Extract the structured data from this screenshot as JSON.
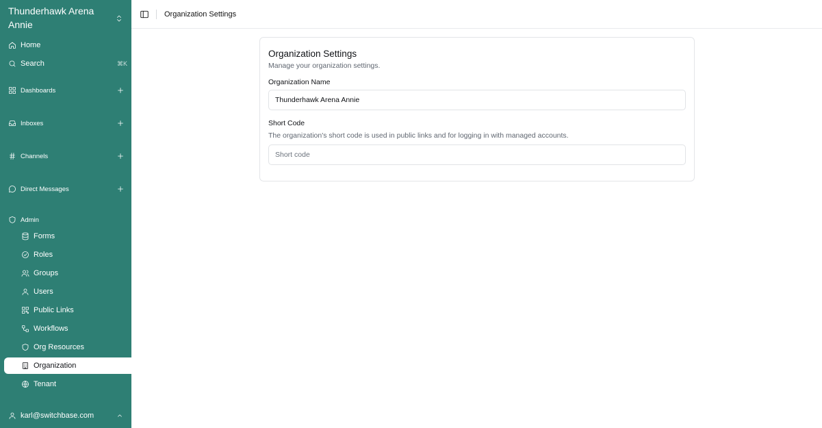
{
  "sidebar": {
    "org_name": "Thunderhawk Arena Annie",
    "nav": {
      "home": "Home",
      "search": "Search",
      "search_shortcut": "⌘K",
      "dashboards": "Dashboards",
      "inboxes": "Inboxes",
      "channels": "Channels",
      "direct_messages": "Direct Messages",
      "admin": "Admin"
    },
    "admin_items": [
      {
        "label": "Forms",
        "icon": "database-icon"
      },
      {
        "label": "Roles",
        "icon": "check-circle-icon"
      },
      {
        "label": "Groups",
        "icon": "users-icon"
      },
      {
        "label": "Users",
        "icon": "user-icon"
      },
      {
        "label": "Public Links",
        "icon": "qr-code-icon"
      },
      {
        "label": "Workflows",
        "icon": "workflow-icon"
      },
      {
        "label": "Org Resources",
        "icon": "shield-icon"
      },
      {
        "label": "Organization",
        "icon": "building-icon",
        "active": true
      },
      {
        "label": "Tenant",
        "icon": "globe-icon"
      }
    ],
    "user_email": "karl@switchbase.com"
  },
  "topbar": {
    "breadcrumb": "Organization Settings"
  },
  "card": {
    "title": "Organization Settings",
    "description": "Manage your organization settings.",
    "org_name_label": "Organization Name",
    "org_name_value": "Thunderhawk Arena Annie",
    "short_code_label": "Short Code",
    "short_code_help": "The organization's short code is used in public links and for logging in with managed accounts.",
    "short_code_value": "",
    "short_code_placeholder": "Short code"
  },
  "colors": {
    "sidebar_bg": "#2e7f74",
    "active_bg": "#ffffff",
    "border": "#e3e5e8"
  }
}
